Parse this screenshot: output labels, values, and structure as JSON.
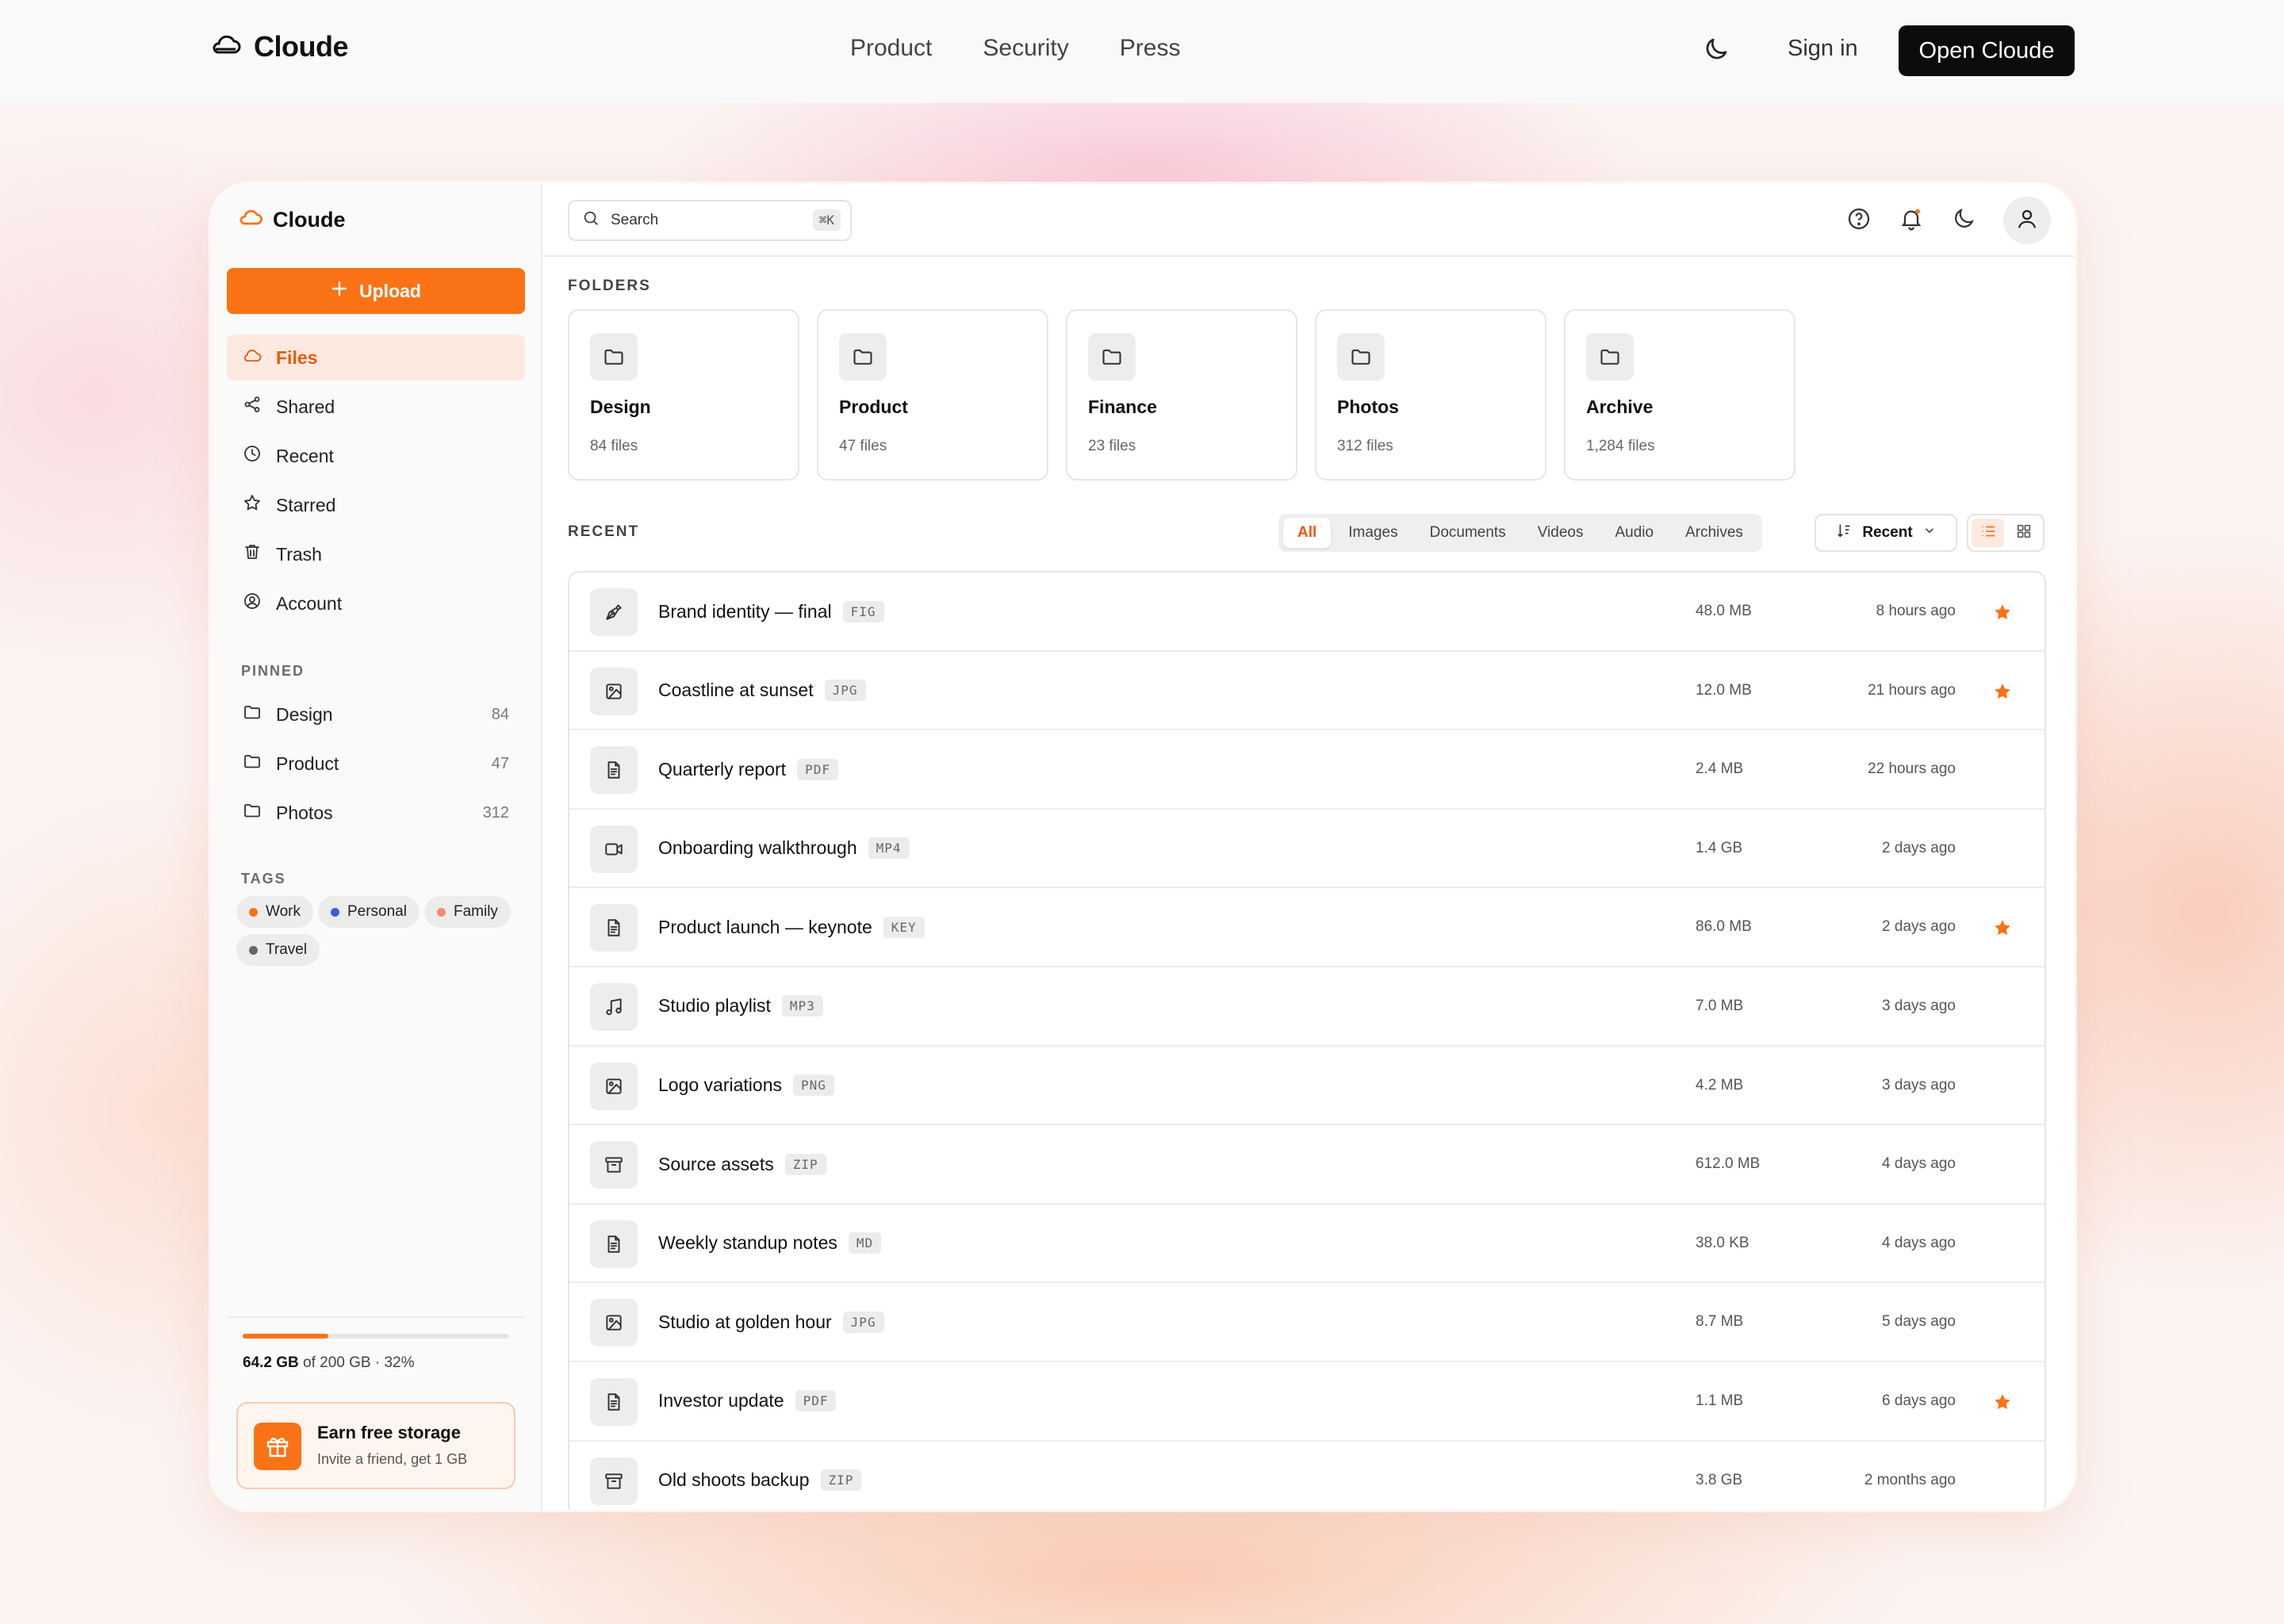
{
  "topnav": {
    "brand": "Cloude",
    "links": [
      "Product",
      "Security",
      "Press"
    ],
    "signin": "Sign in",
    "cta": "Open Cloude"
  },
  "sidebar": {
    "brand": "Cloude",
    "upload": "Upload",
    "nav": [
      {
        "label": "Files",
        "icon": "cloud-icon",
        "active": true
      },
      {
        "label": "Shared",
        "icon": "share-icon"
      },
      {
        "label": "Recent",
        "icon": "clock-icon"
      },
      {
        "label": "Starred",
        "icon": "star-icon"
      },
      {
        "label": "Trash",
        "icon": "trash-icon"
      },
      {
        "label": "Account",
        "icon": "account-icon"
      }
    ],
    "pinned_label": "PINNED",
    "pinned": [
      {
        "label": "Design",
        "count": "84"
      },
      {
        "label": "Product",
        "count": "47"
      },
      {
        "label": "Photos",
        "count": "312"
      }
    ],
    "tags_label": "TAGS",
    "tags": [
      {
        "label": "Work",
        "color": "#f97316"
      },
      {
        "label": "Personal",
        "color": "#3b5bdb"
      },
      {
        "label": "Family",
        "color": "#f28c6b"
      },
      {
        "label": "Travel",
        "color": "#666666"
      }
    ],
    "storage": {
      "used": "64.2 GB",
      "rest": "of 200 GB · 32%",
      "fraction": 0.32
    },
    "earn": {
      "title": "Earn free storage",
      "subtitle": "Invite a friend, get 1 GB"
    }
  },
  "search": {
    "placeholder": "Search",
    "shortcut": "⌘K"
  },
  "folders_label": "FOLDERS",
  "folders": [
    {
      "name": "Design",
      "count": "84 files"
    },
    {
      "name": "Product",
      "count": "47 files"
    },
    {
      "name": "Finance",
      "count": "23 files"
    },
    {
      "name": "Photos",
      "count": "312 files"
    },
    {
      "name": "Archive",
      "count": "1,284 files"
    }
  ],
  "recent_label": "RECENT",
  "filters": [
    "All",
    "Images",
    "Documents",
    "Videos",
    "Audio",
    "Archives"
  ],
  "sort": "Recent",
  "files": [
    {
      "name": "Brand identity — final",
      "ext": "FIG",
      "size": "48.0 MB",
      "time": "8 hours ago",
      "starred": true,
      "icon": "pen-icon"
    },
    {
      "name": "Coastline at sunset",
      "ext": "JPG",
      "size": "12.0 MB",
      "time": "21 hours ago",
      "starred": true,
      "icon": "image-icon"
    },
    {
      "name": "Quarterly report",
      "ext": "PDF",
      "size": "2.4 MB",
      "time": "22 hours ago",
      "starred": false,
      "icon": "document-icon"
    },
    {
      "name": "Onboarding walkthrough",
      "ext": "MP4",
      "size": "1.4 GB",
      "time": "2 days ago",
      "starred": false,
      "icon": "video-icon"
    },
    {
      "name": "Product launch — keynote",
      "ext": "KEY",
      "size": "86.0 MB",
      "time": "2 days ago",
      "starred": true,
      "icon": "document-icon"
    },
    {
      "name": "Studio playlist",
      "ext": "MP3",
      "size": "7.0 MB",
      "time": "3 days ago",
      "starred": false,
      "icon": "music-icon"
    },
    {
      "name": "Logo variations",
      "ext": "PNG",
      "size": "4.2 MB",
      "time": "3 days ago",
      "starred": false,
      "icon": "image-icon"
    },
    {
      "name": "Source assets",
      "ext": "ZIP",
      "size": "612.0 MB",
      "time": "4 days ago",
      "starred": false,
      "icon": "archive-icon"
    },
    {
      "name": "Weekly standup notes",
      "ext": "MD",
      "size": "38.0 KB",
      "time": "4 days ago",
      "starred": false,
      "icon": "document-icon"
    },
    {
      "name": "Studio at golden hour",
      "ext": "JPG",
      "size": "8.7 MB",
      "time": "5 days ago",
      "starred": false,
      "icon": "image-icon"
    },
    {
      "name": "Investor update",
      "ext": "PDF",
      "size": "1.1 MB",
      "time": "6 days ago",
      "starred": true,
      "icon": "document-icon"
    },
    {
      "name": "Old shoots backup",
      "ext": "ZIP",
      "size": "3.8 GB",
      "time": "2 months ago",
      "starred": false,
      "icon": "archive-icon"
    }
  ],
  "colors": {
    "accent": "#f97316"
  }
}
